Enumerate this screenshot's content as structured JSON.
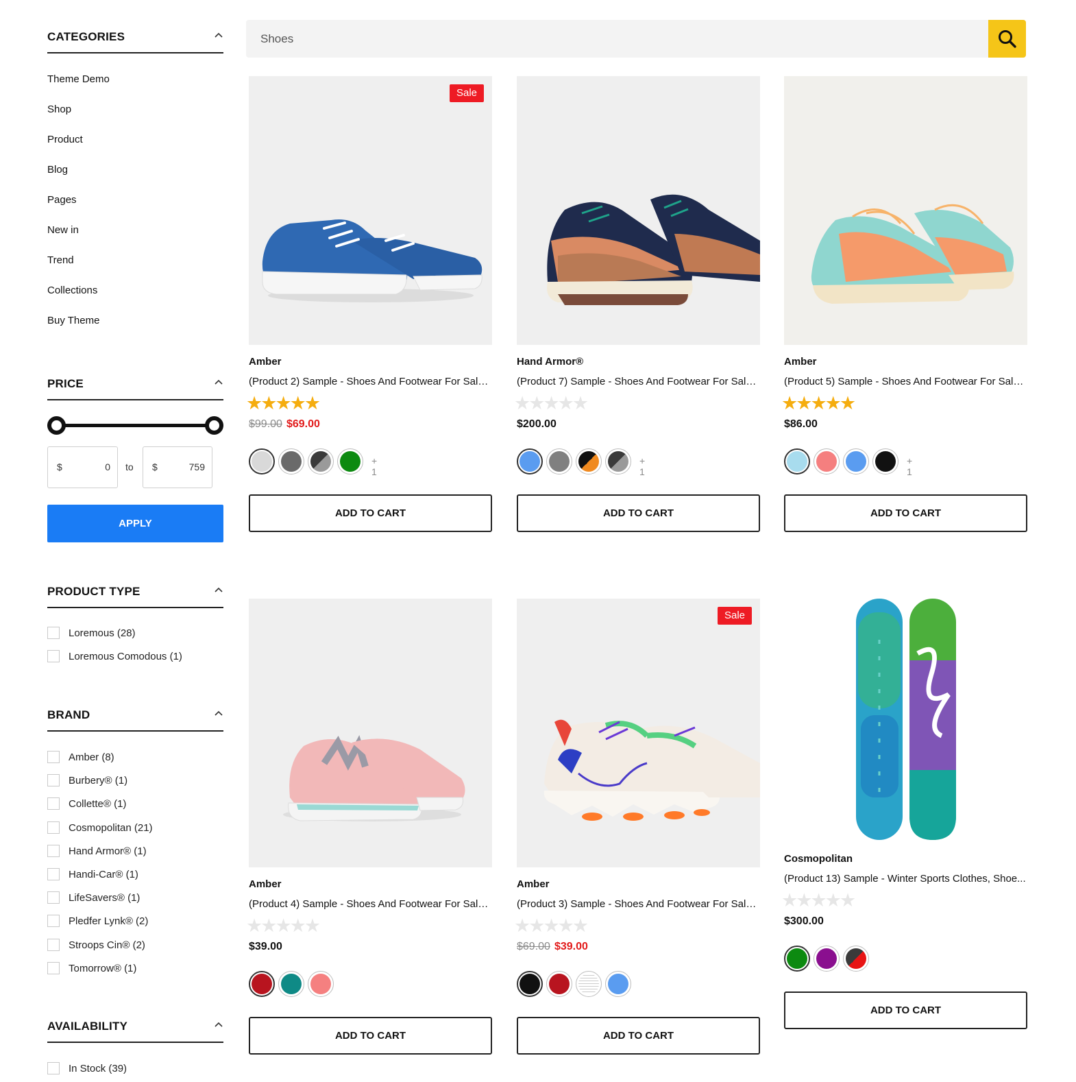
{
  "sidebar": {
    "categories": {
      "title": "CATEGORIES",
      "items": [
        {
          "label": "Theme Demo"
        },
        {
          "label": "Shop"
        },
        {
          "label": "Product"
        },
        {
          "label": "Blog"
        },
        {
          "label": "Pages"
        },
        {
          "label": "New in"
        },
        {
          "label": "Trend"
        },
        {
          "label": "Collections"
        },
        {
          "label": "Buy Theme"
        }
      ]
    },
    "price": {
      "title": "PRICE",
      "currency": "$",
      "min": "0",
      "max": "759",
      "to": "to",
      "apply": "APPLY"
    },
    "product_type": {
      "title": "PRODUCT TYPE",
      "items": [
        {
          "label": "Loremous (28)"
        },
        {
          "label": "Loremous Comodous (1)"
        }
      ]
    },
    "brand": {
      "title": "BRAND",
      "items": [
        {
          "label": "Amber (8)"
        },
        {
          "label": "Burbery® (1)"
        },
        {
          "label": "Collette® (1)"
        },
        {
          "label": "Cosmopolitan (21)"
        },
        {
          "label": "Hand Armor® (1)"
        },
        {
          "label": "Handi-Car® (1)"
        },
        {
          "label": "LifeSavers® (1)"
        },
        {
          "label": "Pledfer Lynk® (2)"
        },
        {
          "label": "Stroops Cin® (2)"
        },
        {
          "label": "Tomorrow® (1)"
        }
      ]
    },
    "availability": {
      "title": "AVAILABILITY",
      "items": [
        {
          "label": "In Stock (39)"
        }
      ]
    }
  },
  "search": {
    "value": "Shoes",
    "icon": "search-icon",
    "button_color": "#f5c518"
  },
  "products": [
    {
      "vendor": "Amber",
      "name": "(Product 2) Sample - Shoes And Footwear For Sale...",
      "rating": 5,
      "old_price": "$99.00",
      "price": "$69.00",
      "sale": "Sale",
      "swatches": [
        "#d9d9d9",
        "#6a6a6a",
        "split:#3a3a3a:#9a9a9a",
        "#0c8a10"
      ],
      "more": "+ 1",
      "cta": "ADD TO CART",
      "image": "blue-canvas-sneakers"
    },
    {
      "vendor": "Hand Armor®",
      "name": "(Product 7) Sample - Shoes And Footwear For Sale...",
      "rating": 0,
      "old_price": "",
      "price": "$200.00",
      "sale": "",
      "swatches": [
        "#5a9cf0",
        "#808080",
        "split:#111111:#f08a20",
        "split:#3a3a3a:#9a9a9a"
      ],
      "more": "+ 1",
      "cta": "ADD TO CART",
      "image": "navy-running-shoes"
    },
    {
      "vendor": "Amber",
      "name": "(Product 5) Sample - Shoes And Footwear For Sale...",
      "rating": 5,
      "old_price": "",
      "price": "$86.00",
      "sale": "",
      "swatches": [
        "#a8dcee",
        "#f57f7f",
        "#5a9cf0",
        "#111111"
      ],
      "more": "+ 1",
      "cta": "ADD TO CART",
      "image": "aqua-orange-trainers"
    },
    {
      "vendor": "Amber",
      "name": "(Product 4) Sample - Shoes And Footwear For Sale...",
      "rating": 0,
      "old_price": "",
      "price": "$39.00",
      "sale": "",
      "swatches": [
        "#b8141f",
        "#0f8a86",
        "#f58080"
      ],
      "more": "",
      "cta": "ADD TO CART",
      "image": "pink-suede-sneakers"
    },
    {
      "vendor": "Amber",
      "name": "(Product 3) Sample - Shoes And Footwear For Sale...",
      "rating": 0,
      "old_price": "$69.00",
      "price": "$39.00",
      "sale": "Sale",
      "swatches": [
        "#111111",
        "#b8141f",
        "stripe:#ffffff:#cccccc",
        "#5a9cf0"
      ],
      "more": "",
      "cta": "ADD TO CART",
      "image": "colorful-react-sneakers"
    },
    {
      "vendor": "Cosmopolitan",
      "name": "(Product 13) Sample - Winter Sports Clothes, Shoe...",
      "rating": 0,
      "old_price": "",
      "price": "$300.00",
      "sale": "",
      "swatches": [
        "#0c8a10",
        "#8a0f8f",
        "split:#3a3a3a:#e81414"
      ],
      "more": "",
      "cta": "ADD TO CART",
      "image": "snowboards"
    }
  ],
  "colors": {
    "apply_button": "#1a7cf5",
    "sale_badge": "#ee1b24",
    "sale_price": "#e21b1b",
    "star": "#f5ad0f"
  }
}
